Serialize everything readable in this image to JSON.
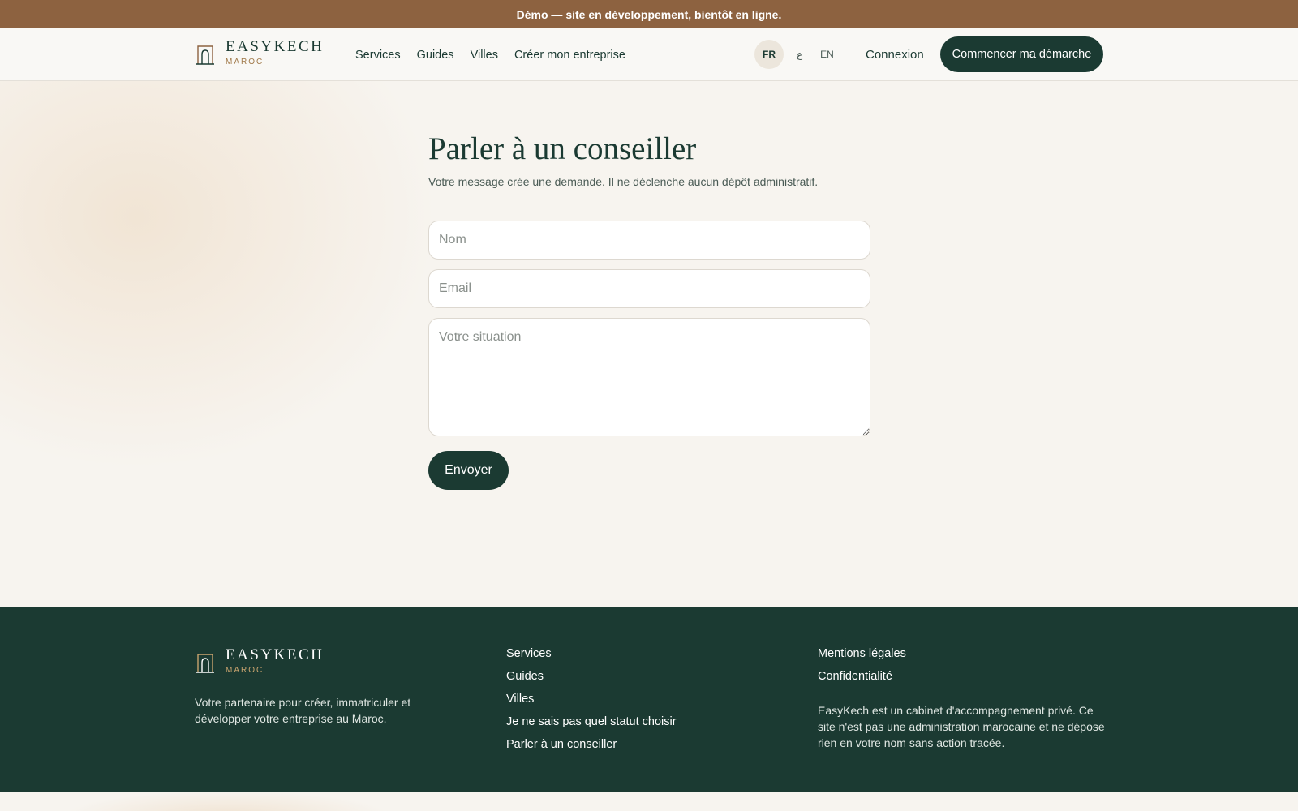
{
  "banner": {
    "text": "Démo — site en développement, bientôt en ligne."
  },
  "brand": {
    "name": "EASYKECH",
    "tagline": "MAROC"
  },
  "nav": {
    "items": [
      "Services",
      "Guides",
      "Villes",
      "Créer mon entreprise"
    ]
  },
  "languages": {
    "fr": "FR",
    "ar": "ع",
    "en": "EN"
  },
  "header": {
    "login": "Connexion",
    "cta": "Commencer ma démarche"
  },
  "form": {
    "title": "Parler à un conseiller",
    "subtitle": "Votre message crée une demande. Il ne déclenche aucun dépôt administratif.",
    "name_placeholder": "Nom",
    "email_placeholder": "Email",
    "message_placeholder": "Votre situation",
    "submit": "Envoyer"
  },
  "footer": {
    "description": "Votre partenaire pour créer, immatriculer et développer votre entreprise au Maroc.",
    "links": [
      "Services",
      "Guides",
      "Villes",
      "Je ne sais pas quel statut choisir",
      "Parler à un conseiller"
    ],
    "legal": [
      "Mentions légales",
      "Confidentialité"
    ],
    "note": "EasyKech est un cabinet d'accompagnement privé. Ce site n'est pas une administration marocaine et ne dépose rien en votre nom sans action tracée."
  },
  "colors": {
    "banner": "#8d6240",
    "primary": "#1b3a32",
    "accent": "#a07848",
    "background": "#f7f4ef"
  },
  "icons": {
    "logo": "arch-door-icon"
  }
}
